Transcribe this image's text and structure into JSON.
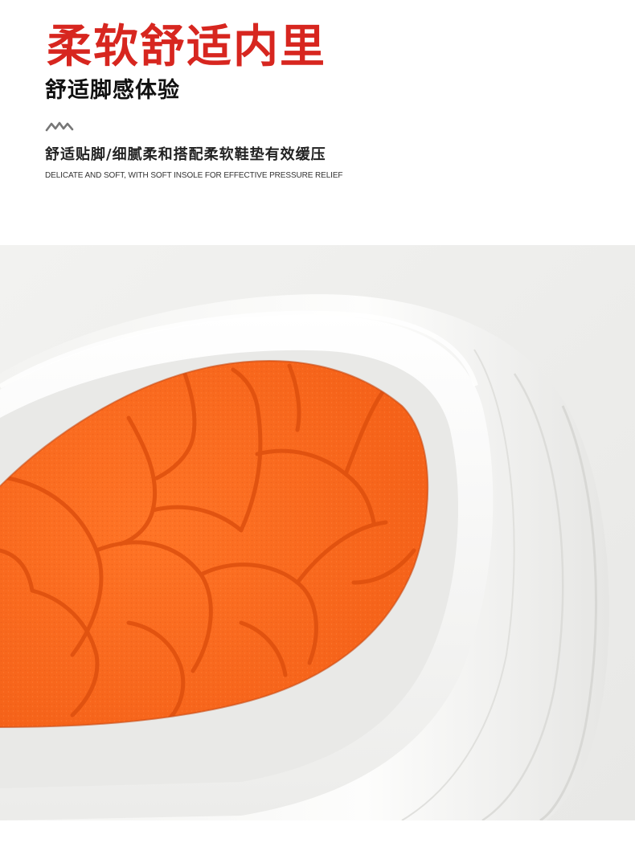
{
  "header": {
    "title": "柔软舒适内里",
    "subtitle": "舒适脚感体验",
    "divider_icon": "wave-icon",
    "description_cn": "舒适贴脚/细腻柔和搭配柔软鞋垫有效缓压",
    "description_en": "DELICATE AND SOFT, WITH SOFT INSOLE FOR EFFECTIVE PRESSURE RELIEF"
  },
  "colors": {
    "title_red": "#d7261f",
    "insole_orange": "#ff6a1e",
    "groove_orange": "#e85410",
    "shoe_white": "#fafaf8",
    "photo_background": "#efefed"
  },
  "photo": {
    "subject": "shoe-insole-closeup"
  }
}
